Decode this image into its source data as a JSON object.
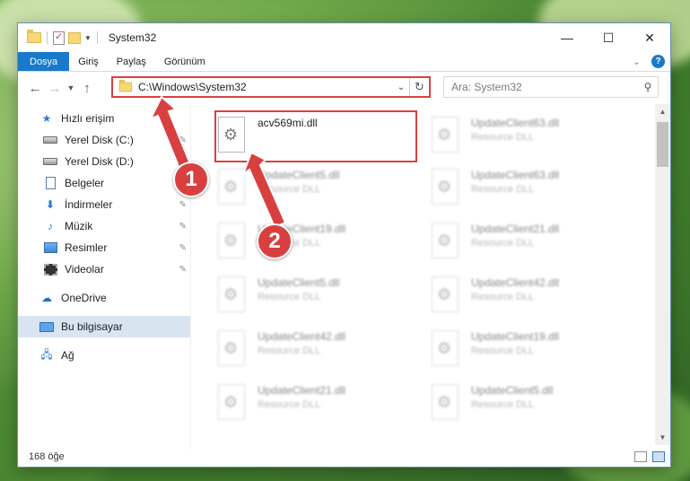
{
  "window": {
    "title": "System32",
    "controls": {
      "minimize": "—",
      "maximize": "☐",
      "close": "✕"
    }
  },
  "ribbon": {
    "tabs": [
      {
        "label": "Dosya",
        "active": true
      },
      {
        "label": "Giriş"
      },
      {
        "label": "Paylaş"
      },
      {
        "label": "Görünüm"
      }
    ],
    "help_label": "?"
  },
  "address": {
    "path": "C:\\Windows\\System32",
    "search_placeholder": "Ara: System32"
  },
  "sidebar": {
    "items": [
      {
        "label": "Hızlı erişim",
        "icon": "star-icon"
      },
      {
        "label": "Yerel Disk (C:)",
        "icon": "drive-icon",
        "pinned": true
      },
      {
        "label": "Yerel Disk (D:)",
        "icon": "drive-icon"
      },
      {
        "label": "Belgeler",
        "icon": "document-icon"
      },
      {
        "label": "İndirmeler",
        "icon": "download-icon",
        "pinned": true
      },
      {
        "label": "Müzik",
        "icon": "music-icon",
        "pinned": true
      },
      {
        "label": "Resimler",
        "icon": "picture-icon",
        "pinned": true
      },
      {
        "label": "Videolar",
        "icon": "video-icon",
        "pinned": true
      },
      {
        "label": "OneDrive",
        "icon": "cloud-icon"
      },
      {
        "label": "Bu bilgisayar",
        "icon": "computer-icon",
        "selected": true
      },
      {
        "label": "Ağ",
        "icon": "network-icon"
      }
    ]
  },
  "files": [
    {
      "name": "acv569mi.dll",
      "type": "",
      "highlighted": true
    },
    {
      "name": "UpdateClient63.dll",
      "type": "Resource DLL"
    },
    {
      "name": "UpdateClient5.dll",
      "type": "Resource DLL"
    },
    {
      "name": "UpdateClient63.dll",
      "type": "Resource DLL"
    },
    {
      "name": "UpdateClient19.dll",
      "type": "Resource DLL"
    },
    {
      "name": "UpdateClient21.dll",
      "type": "Resource DLL"
    },
    {
      "name": "UpdateClient5.dll",
      "type": "Resource DLL"
    },
    {
      "name": "UpdateClient42.dll",
      "type": "Resource DLL"
    },
    {
      "name": "UpdateClient42.dll",
      "type": "Resource DLL"
    },
    {
      "name": "UpdateClient19.dll",
      "type": "Resource DLL"
    },
    {
      "name": "UpdateClient21.dll",
      "type": "Resource DLL"
    },
    {
      "name": "UpdateClient5.dll",
      "type": "Resource DLL"
    }
  ],
  "status": {
    "item_count": "168 öğe"
  },
  "annotations": {
    "marker1": "1",
    "marker2": "2"
  },
  "colors": {
    "accent": "#1979ca",
    "annotation": "#d84040"
  }
}
